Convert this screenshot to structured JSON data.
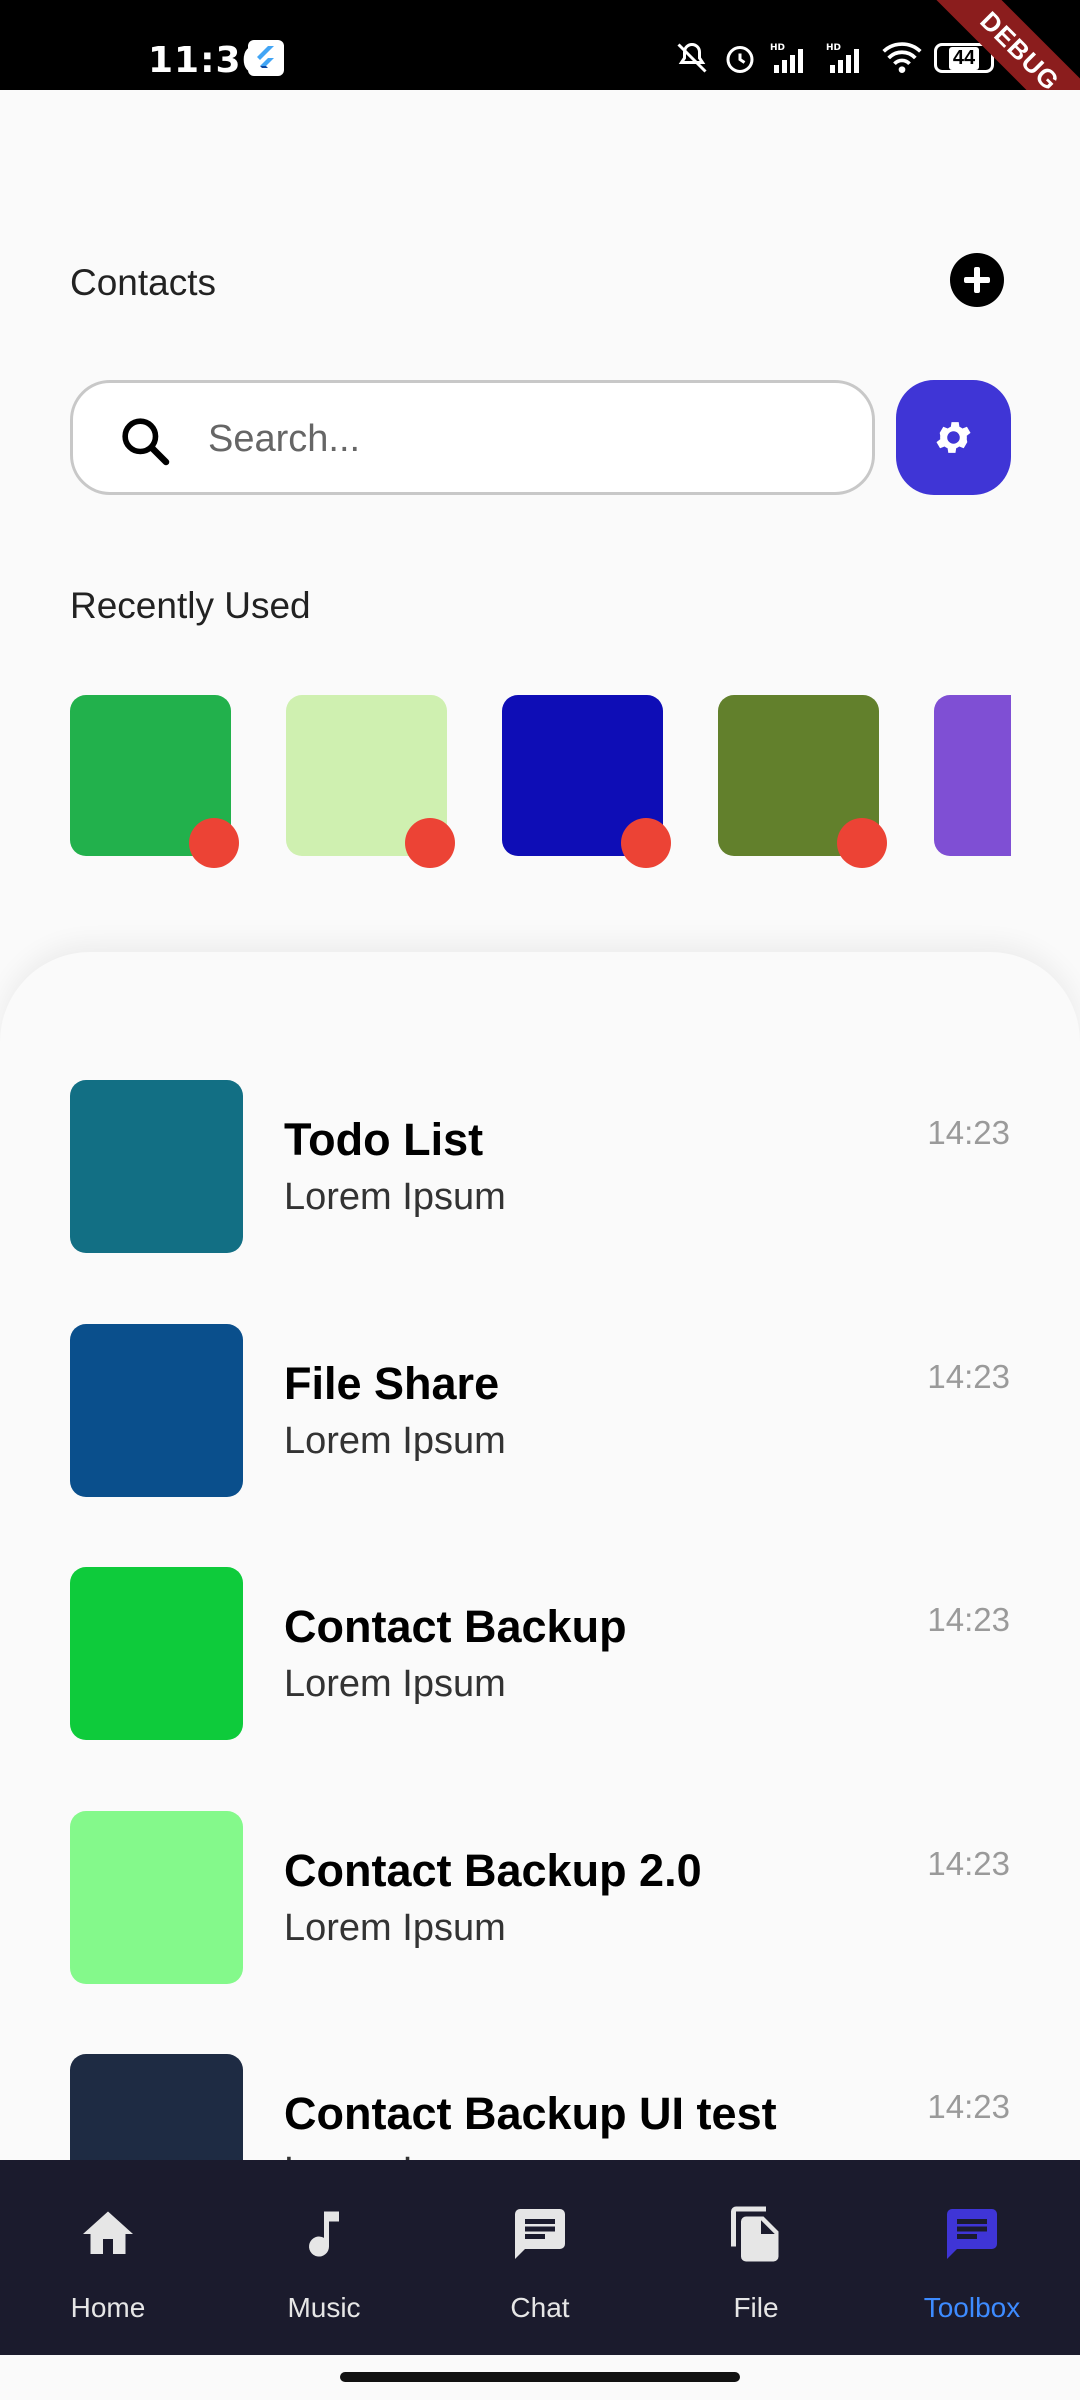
{
  "status_bar": {
    "time": "11:36",
    "battery": "44",
    "debug_label": "DEBUG"
  },
  "header": {
    "title": "Contacts"
  },
  "search": {
    "placeholder": "Search..."
  },
  "recent": {
    "label": "Recently Used",
    "items": [
      {
        "color": "#22b14c",
        "dot": true
      },
      {
        "color": "#cff0b0",
        "dot": true
      },
      {
        "color": "#0e0db6",
        "dot": true
      },
      {
        "color": "#62802c",
        "dot": true
      },
      {
        "color": "#7f4fd4",
        "dot": false
      }
    ]
  },
  "list": [
    {
      "title": "Todo List",
      "subtitle": "Lorem Ipsum",
      "time": "14:23",
      "color": "#126f84"
    },
    {
      "title": "File Share",
      "subtitle": "Lorem Ipsum",
      "time": "14:23",
      "color": "#0a4f8c"
    },
    {
      "title": "Contact Backup",
      "subtitle": "Lorem Ipsum",
      "time": "14:23",
      "color": "#0ecb3b"
    },
    {
      "title": "Contact Backup 2.0",
      "subtitle": "Lorem Ipsum",
      "time": "14:23",
      "color": "#84f98b"
    },
    {
      "title": "Contact Backup UI test",
      "subtitle": "Lorem Ipsum",
      "time": "14:23",
      "color": "#1e2b43"
    }
  ],
  "nav": {
    "items": [
      {
        "label": "Home",
        "icon": "home-icon",
        "active": false
      },
      {
        "label": "Music",
        "icon": "music-note-icon",
        "active": false
      },
      {
        "label": "Chat",
        "icon": "chat-icon",
        "active": false
      },
      {
        "label": "File",
        "icon": "file-icon",
        "active": false
      },
      {
        "label": "Toolbox",
        "icon": "toolbox-icon",
        "active": true
      }
    ],
    "active_color": "#3d8bff"
  },
  "colors": {
    "accent": "#3f35d6",
    "badge": "#ec4335",
    "nav_background": "#1b1b2d"
  }
}
